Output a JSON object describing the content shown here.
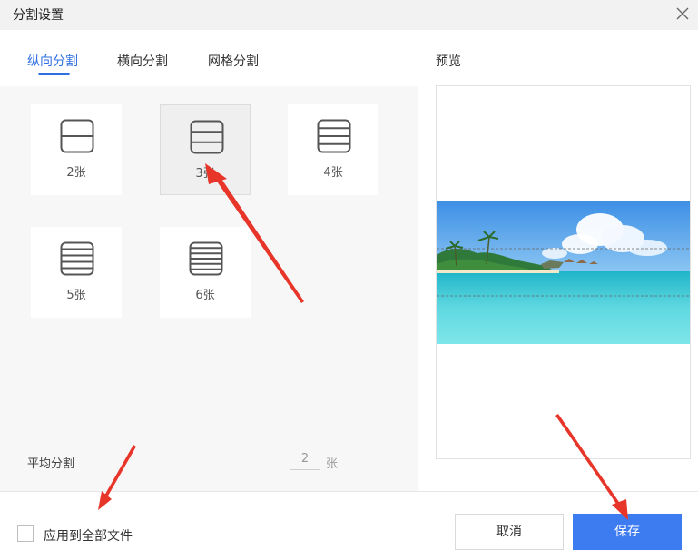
{
  "dialog": {
    "title": "分割设置"
  },
  "tabs": [
    {
      "label": "纵向分割",
      "active": true
    },
    {
      "label": "横向分割",
      "active": false
    },
    {
      "label": "网格分割",
      "active": false
    }
  ],
  "options": [
    {
      "label": "2张",
      "lines": 1,
      "selected": false
    },
    {
      "label": "3张",
      "lines": 2,
      "selected": true
    },
    {
      "label": "4张",
      "lines": 3,
      "selected": false
    },
    {
      "label": "5张",
      "lines": 4,
      "selected": false
    },
    {
      "label": "6张",
      "lines": 5,
      "selected": false
    }
  ],
  "average": {
    "label": "平均分割",
    "value": "2",
    "unit": "张"
  },
  "preview": {
    "label": "预览"
  },
  "footer": {
    "apply_all_label": "应用到全部文件",
    "apply_all_checked": false,
    "cancel_label": "取消",
    "save_label": "保存"
  },
  "colors": {
    "accent": "#2f6fe0",
    "save_button": "#3d7bf0",
    "annotation_arrow": "#e8352a"
  }
}
